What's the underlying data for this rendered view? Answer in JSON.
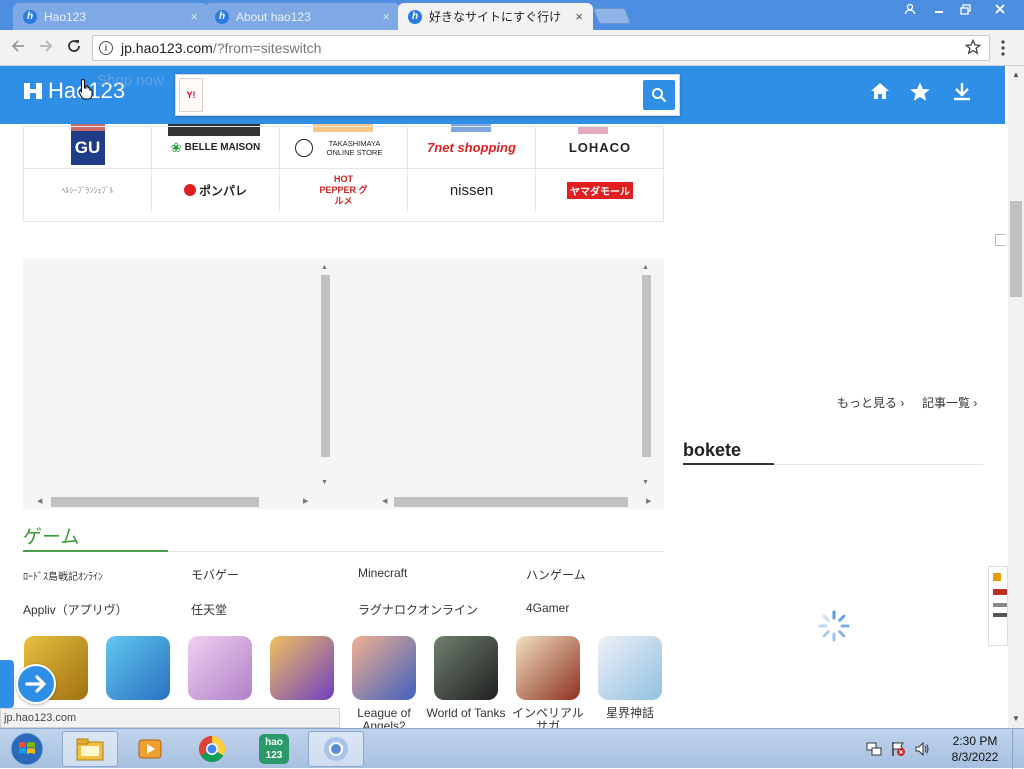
{
  "browser": {
    "tabs": [
      {
        "label": "Hao123"
      },
      {
        "label": "About hao123"
      },
      {
        "label": "好きなサイトにすぐ行け"
      }
    ],
    "url_host": "jp.hao123.com",
    "url_rest": "/?from=siteswitch",
    "tab_close": "×"
  },
  "header": {
    "logo_text": "Hao123",
    "shop_now": "Shop now",
    "search_value": "",
    "yahoo_badge": "Y!"
  },
  "shops": {
    "row1": [
      "GU",
      "BELLE MAISON",
      "TAKASHIMAYA ONLINE STORE",
      "7net shopping",
      "LOHACO"
    ],
    "row2": [
      "ﾍﾙｼｰﾌﾞﾗﾝｼｪﾌﾞﾙ",
      "ポンパレ",
      "HOT PEPPER グルメ",
      "nissen",
      "ヤマダモール"
    ]
  },
  "games": {
    "title": "ゲーム",
    "links": [
      [
        "ﾛｰﾄﾞｽ島戦記ｵﾝﾗｲﾝ",
        "モバゲー",
        "Minecraft",
        "ハンゲーム"
      ],
      [
        "Appliv（アプリヴ）",
        "任天堂",
        "ラグナロクオンライン",
        "4Gamer"
      ]
    ],
    "tiles": [
      {
        "caption": "",
        "color": "#c8a020"
      },
      {
        "caption": "",
        "color": "#3aa8e0"
      },
      {
        "caption": "",
        "color": "#d9a8d8"
      },
      {
        "caption": "",
        "color": "#8a5ad0"
      },
      {
        "caption": "League of Angels2",
        "color": "#5a7ac8"
      },
      {
        "caption": "World of Tanks",
        "color": "#3a3a3a"
      },
      {
        "caption": "インペリアル サガ",
        "color": "#a04030"
      },
      {
        "caption": "星界神話",
        "color": "#a8d0e8"
      }
    ]
  },
  "right": {
    "more": "もっと見る",
    "articles": "記事一覧",
    "bokete": "bokete"
  },
  "status_url": "jp.hao123.com",
  "taskbar": {
    "time": "2:30 PM",
    "date": "8/3/2022"
  }
}
